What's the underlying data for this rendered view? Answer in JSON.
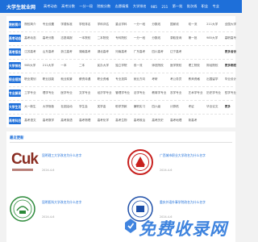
{
  "header": {
    "logo": "大学生就业网",
    "nav": [
      "高考动态",
      "高考分数",
      "一分一段",
      "院校分数",
      "志愿填报",
      "大学排名",
      "985",
      "211",
      "第一批",
      "批次线",
      "职业",
      "专业"
    ]
  },
  "rows": [
    {
      "label": "院校简介",
      "color": "#1e6fd9",
      "links": [
        "院校简介",
        "专业设置",
        "学费标准",
        "学校排名",
        "学科评估",
        "重点学科",
        "一分一段",
        "分数线",
        "国家线",
        "双一流",
        "211大学",
        "全国大学"
      ]
    },
    {
      "label": "高考动态",
      "color": "#1e6fd9",
      "links": [
        "高考动态",
        "高考分数",
        "志愿填报",
        "一本院校",
        "二本院校",
        "专科院校",
        "一分一段",
        "分数线",
        "录取查询",
        "第一批",
        "985大学",
        "高职高专"
      ]
    },
    {
      "label": "高考报名",
      "color": "#1e6fd9",
      "links": [
        "江苏高考",
        "山东高考",
        "浙江高考",
        "湖南高考",
        "湖北高考",
        "河南高考",
        "广东高考",
        "四川高考",
        "辽宁高考",
        "",
        "",
        "更多省份"
      ]
    },
    {
      "label": "大学排名",
      "color": "#1e6fd9",
      "links": [
        "985大学",
        "211大学",
        "一本",
        "二本",
        "民办大学",
        "独立学院",
        "双一流",
        "师范院校",
        "医学院校",
        "理工院校",
        "财经院校",
        "更多院校"
      ]
    },
    {
      "label": "职业规划",
      "color": "#1e6fd9",
      "links": [
        "职业规划",
        "职业技能",
        "就业前景",
        "薪资待遇",
        "职业资格",
        "专业选择",
        "就业方向",
        "考研",
        "考公务员",
        "教师资格",
        "出国留学",
        "毕业设计"
      ]
    },
    {
      "label": "专业解读",
      "color": "#1e6fd9",
      "links": [
        "工学专业",
        "理学专业",
        "医学专业",
        "文学专业",
        "经济学专业",
        "管理学专业",
        "法学专业",
        "教育学专业",
        "农学专业",
        "艺术学专业",
        "历史学专业",
        "哲学专业"
      ]
    },
    {
      "label": "大学生活",
      "color": "#1e6fd9",
      "links": [
        "大一新生",
        "大学宿舍",
        "社团活动",
        "学生会",
        "奖学金",
        "助学贷款",
        "兼职实习",
        "四六级",
        "计算机",
        "考证",
        "毕业论文",
        "更多"
      ]
    },
    {
      "label": "高考科目",
      "color": "#1e6fd9",
      "links": [
        "高考语文",
        "高考数学",
        "高考英语",
        "高考物理",
        "高考化学",
        "高考生物",
        "高考政治",
        "高考历史",
        "高考地理",
        "新高考",
        "",
        ""
      ]
    }
  ],
  "recent": {
    "title": "最近更新",
    "items": [
      {
        "title": "昆明理工大学改名为什么名字",
        "date": "2024-4-6",
        "logo_text": "Cuk"
      },
      {
        "title": "广西城市职业大学改名为什么名字",
        "date": "2024-4-6",
        "logo_text": ""
      },
      {
        "title": "昆明医科大学改名为什么名字",
        "date": "2024-4-6",
        "logo_text": ""
      },
      {
        "title": "重庆外语外事学院改名为什么名字",
        "date": "2024-4-6",
        "logo_text": ""
      }
    ]
  },
  "watermark": {
    "text": "免费收录网"
  },
  "colors": {
    "brand": "#1e6fd9",
    "seal_red": "#c8201e",
    "logo_brown": "#8a2d22"
  }
}
